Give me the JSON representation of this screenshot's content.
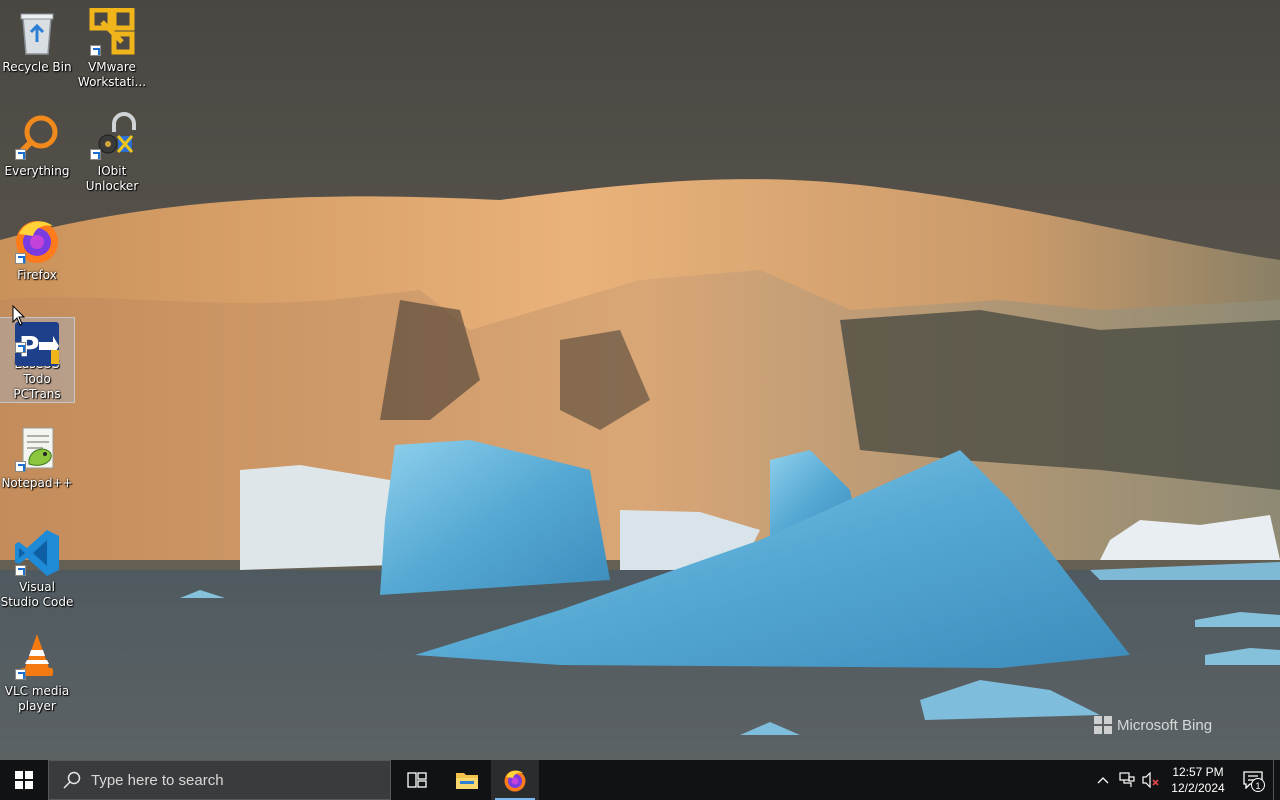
{
  "desktop": {
    "icons": [
      {
        "label": "Recycle Bin",
        "icon": "recycle-bin-icon",
        "shortcut": false
      },
      {
        "label": "VMware Workstati...",
        "icon": "vmware-icon",
        "shortcut": true
      },
      {
        "label": "Everything",
        "icon": "everything-search-icon",
        "shortcut": true
      },
      {
        "label": "IObit Unlocker",
        "icon": "iobit-unlocker-icon",
        "shortcut": true
      },
      {
        "label": "Firefox",
        "icon": "firefox-icon",
        "shortcut": true
      },
      {
        "label": "EaseUS Todo PCTrans",
        "icon": "easeus-pctrans-icon",
        "shortcut": true,
        "selected": true
      },
      {
        "label": "Notepad++",
        "icon": "notepad-plus-plus-icon",
        "shortcut": true
      },
      {
        "label": "Visual Studio Code",
        "icon": "vscode-icon",
        "shortcut": true
      },
      {
        "label": "VLC media player",
        "icon": "vlc-icon",
        "shortcut": true
      }
    ],
    "watermark": "Microsoft Bing"
  },
  "taskbar": {
    "start_icon": "windows-logo-icon",
    "search": {
      "placeholder": "Type here to search",
      "icon": "search-icon"
    },
    "pinned": [
      {
        "name": "task-view",
        "icon": "task-view-icon"
      },
      {
        "name": "file-explorer",
        "icon": "folder-icon"
      },
      {
        "name": "firefox",
        "icon": "firefox-icon",
        "active": true
      }
    ],
    "tray": {
      "icons": [
        "chevron-up-icon",
        "network-icon",
        "volume-muted-icon"
      ],
      "time": "12:57 PM",
      "date": "12/2/2024",
      "notifications_count": "1"
    }
  },
  "colors": {
    "taskbar_bg": "#111214",
    "search_bg": "#3a3b3d",
    "active_indicator": "#7bb6ef"
  }
}
